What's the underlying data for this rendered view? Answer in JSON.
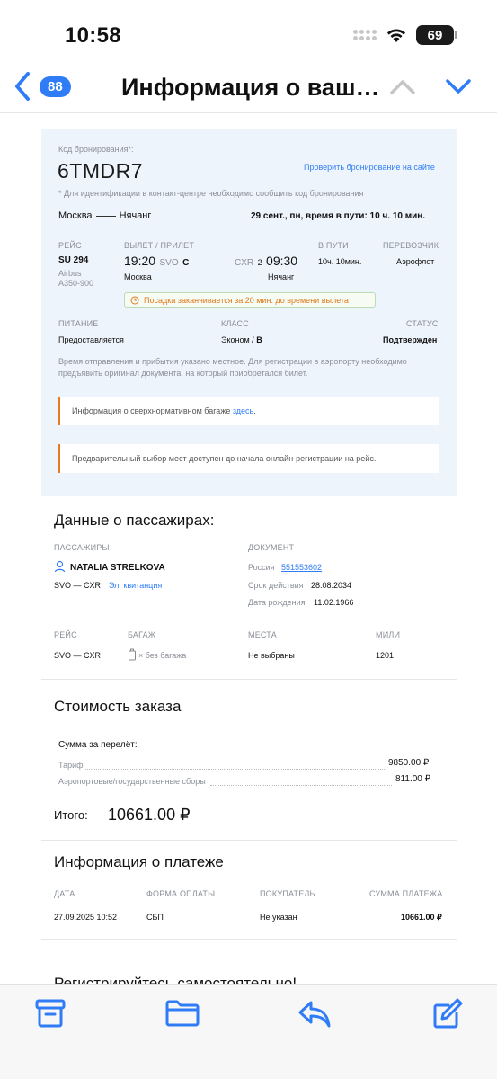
{
  "status": {
    "time": "10:58",
    "battery": "69"
  },
  "nav": {
    "badge": "88",
    "title": "Информация о ваш…"
  },
  "booking": {
    "pnr_label": "Код бронирования*:",
    "pnr": "6TMDR7",
    "check_link": "Проверить бронирование на сайте",
    "pnr_note": "* Для идентификации в контакт-центре необходимо сообщить код бронирования",
    "from_city": "Москва",
    "to_city": "Нячанг",
    "date_info": "29 сент., пн, время в пути: 10 ч. 10 мин.",
    "col_flight": "РЕЙС",
    "col_dep_arr": "ВЫЛЕТ / ПРИЛЕТ",
    "col_duration": "В ПУТИ",
    "col_carrier": "ПЕРЕВОЗЧИК",
    "flight_no": "SU 294",
    "aircraft_1": "Airbus",
    "aircraft_2": "A350-900",
    "dep_time": "19:20",
    "dep_code": "SVO",
    "dep_term": "C",
    "dep_city": "Москва",
    "arr_code": "CXR",
    "arr_term": "2",
    "arr_time": "09:30",
    "arr_city": "Нячанг",
    "duration": "10ч. 10мин.",
    "carrier": "Аэрофлот",
    "boarding_warning": "Посадка заканчивается за 20 мин. до времени вылета",
    "col_meal": "ПИТАНИЕ",
    "col_class": "КЛАСС",
    "col_status": "СТАТУС",
    "meal": "Предоставляется",
    "class_name": "Эконом / ",
    "class_code": "B",
    "status": "Подтвержден",
    "time_note_1": "Время отправления и прибытия указано местное. Для регистрации в аэропорту необходимо",
    "time_note_2": "предъявить оригинал документа, на который приобретался билет.",
    "baggage_note": "Информация о сверхнормативном багаже ",
    "baggage_link": "здесь",
    "baggage_note_end": ".",
    "seats_note": "Предварительный выбор мест доступен до начала онлайн-регистрации на рейс."
  },
  "passengers": {
    "title": "Данные о пассажирах:",
    "col_passengers": "ПАССАЖИРЫ",
    "col_document": "ДОКУМЕНТ",
    "name": "NATALIA STRELKOVA",
    "route": "SVO — CXR",
    "ticket_link": "Эл. квитанция",
    "doc_country": "Россия",
    "doc_number": "551553602",
    "validity_label": "Срок действия",
    "validity": "28.08.2034",
    "birth_label": "Дата рождения",
    "birth": "11.02.1966",
    "col_flight": "РЕЙС",
    "col_baggage": "БАГАЖ",
    "col_seats": "МЕСТА",
    "col_miles": "МИЛИ",
    "flight_route": "SVO — CXR",
    "baggage": "× без багажа",
    "seats": "Не выбраны",
    "miles": "1201"
  },
  "cost": {
    "title": "Стоимость заказа",
    "subtitle": "Сумма за перелёт:",
    "tariff_label": "Тариф",
    "tariff": "9850.00 ₽",
    "fees_label": "Аэропортовые/государственные сборы",
    "fees": "811.00 ₽",
    "total_label": "Итого:",
    "total": "10661.00 ₽"
  },
  "payment": {
    "title": "Информация о платеже",
    "col_date": "ДАТА",
    "col_form": "ФОРМА ОПЛАТЫ",
    "col_buyer": "ПОКУПАТЕЛЬ",
    "col_sum": "СУММА ПЛАТЕЖА",
    "date": "27.09.2025 10:52",
    "form": "СБП",
    "buyer": "Не указан",
    "sum": "10661.00 ₽"
  },
  "footer_partial": "Регистрируйтесь самостоятельно!",
  "colors": {
    "accent": "#2f7cf6",
    "warning": "#e07a1c",
    "card_bg": "#eef4fb"
  },
  "toolbar": {
    "icons": [
      "archive-icon",
      "folder-icon",
      "reply-icon",
      "compose-icon"
    ]
  }
}
